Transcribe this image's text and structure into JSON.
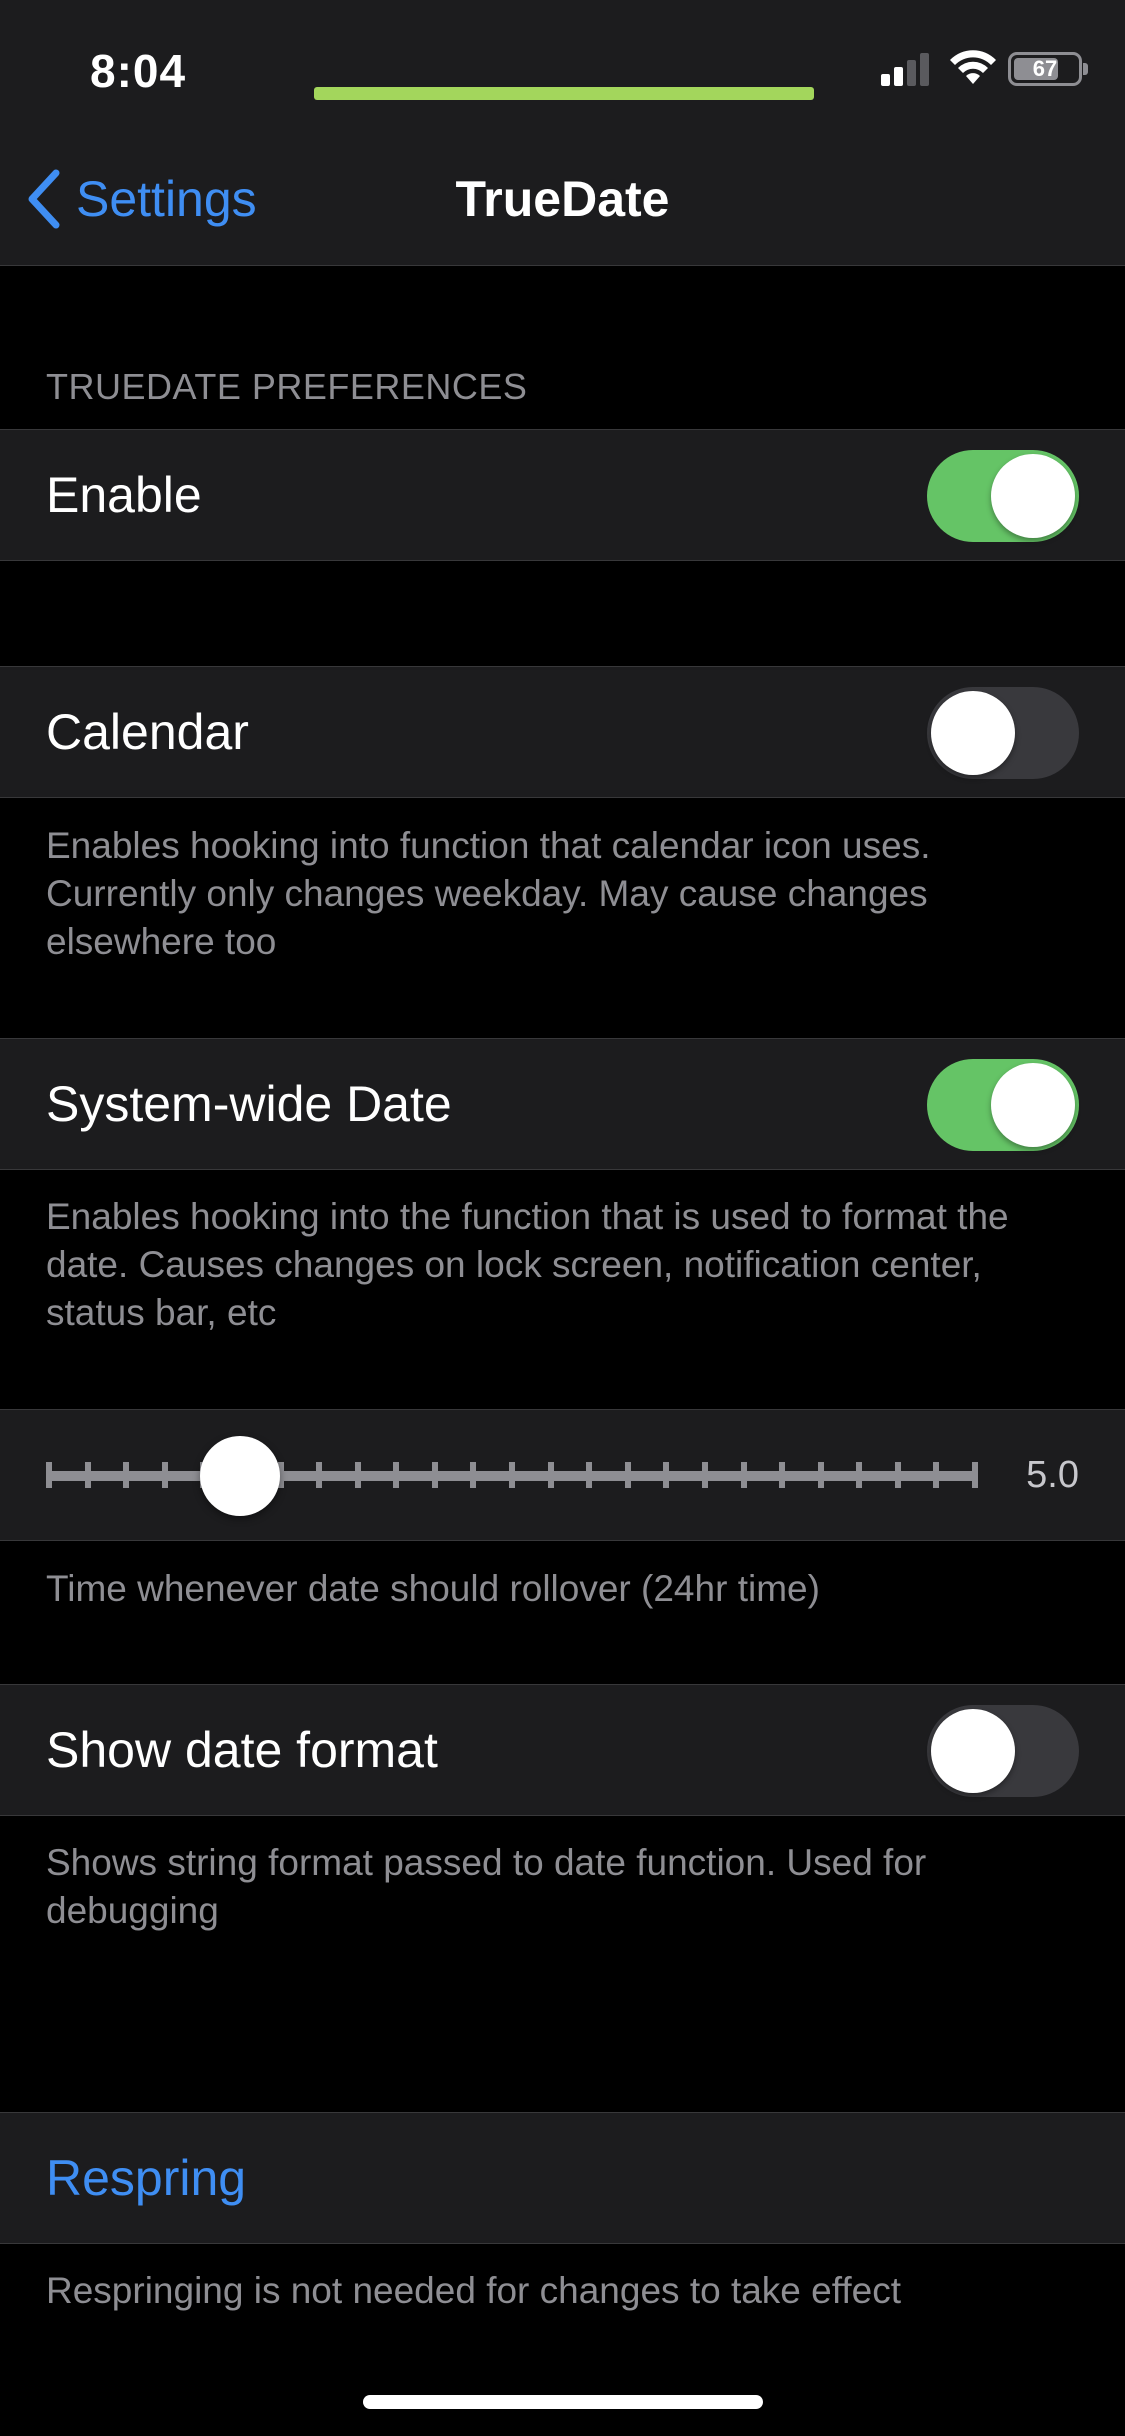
{
  "status_bar": {
    "time": "8:04",
    "battery_percent": "67",
    "accent_bar_color": "#a3d65c"
  },
  "nav": {
    "back_label": "Settings",
    "title": "TrueDate"
  },
  "section_header": "TRUEDATE PREFERENCES",
  "rows": {
    "enable": {
      "label": "Enable",
      "on": true
    },
    "calendar": {
      "label": "Calendar",
      "on": false,
      "footer": "Enables hooking into function that calendar icon uses. Currently only changes weekday. May cause changes elsewhere too"
    },
    "system_wide_date": {
      "label": "System-wide Date",
      "on": true,
      "footer": "Enables hooking into the function that is used to format the date. Causes changes on lock screen, notification center, status bar, etc"
    },
    "rollover_slider": {
      "value": 5.0,
      "min": 0,
      "max": 24,
      "value_text": "5.0",
      "footer": "Time whenever date should rollover (24hr time)"
    },
    "show_date_format": {
      "label": "Show date format",
      "on": false,
      "footer": "Shows string format passed to date function. Used for debugging"
    },
    "respring": {
      "label": "Respring",
      "footer": "Respringing is not needed for changes to take effect"
    }
  },
  "colors": {
    "accent_blue": "#3f8ef3",
    "switch_on": "#65c466",
    "switch_off": "#39393d"
  },
  "icons": [
    "chevron-left-icon",
    "signal-icon",
    "wifi-icon",
    "battery-icon"
  ]
}
